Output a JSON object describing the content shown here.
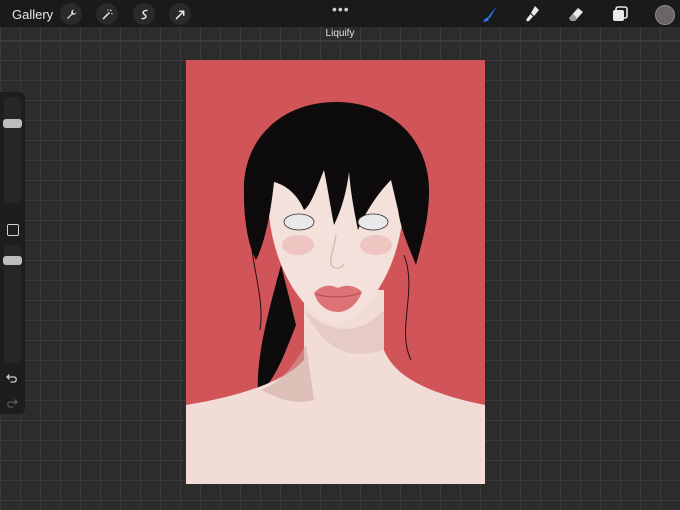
{
  "topbar": {
    "gallery_label": "Gallery",
    "left_tools": [
      "wrench-icon",
      "magic-wand-icon",
      "selection-icon",
      "transform-arrow-icon"
    ],
    "more_label": "•••",
    "right_tools": [
      "brush-icon",
      "smudge-icon",
      "eraser-icon",
      "layers-icon"
    ],
    "active_tool": "brush-icon",
    "accent_color": "#2f7bff",
    "current_color": "#6d6466"
  },
  "mode": {
    "label": "Liquify"
  },
  "sidebar": {
    "brush_size_level": 0.2,
    "opacity_level": 0.1,
    "icons": [
      "modify-square-icon",
      "undo-icon",
      "redo-icon"
    ]
  },
  "canvas": {
    "background_color": "#d05458",
    "skin_color": "#f1dcd6",
    "hair_color": "#0d0b0b",
    "lip_color": "#d9686b"
  }
}
